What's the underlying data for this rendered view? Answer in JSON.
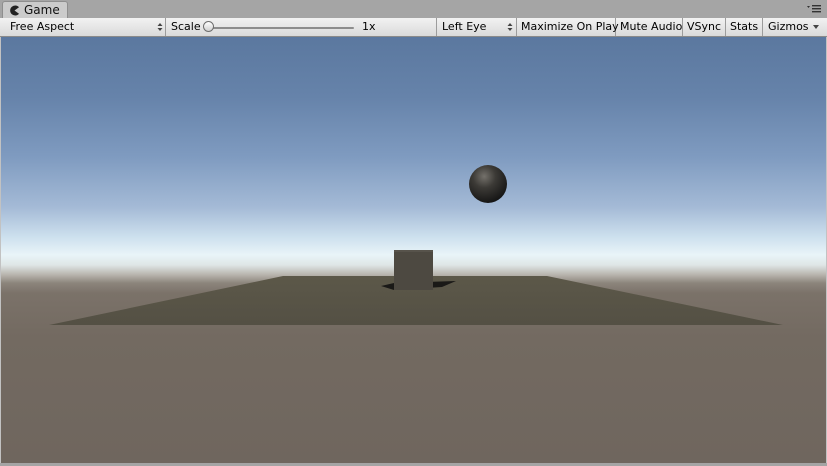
{
  "window": {
    "tab_title": "Game",
    "tab_icon": "pacman-game-icon",
    "panel_menu_icon": "panel-menu-icon"
  },
  "toolbar": {
    "aspect": {
      "value": "Free Aspect"
    },
    "scale": {
      "label": "Scale",
      "value_text": "1x",
      "slider_fraction": 0.0
    },
    "eye": {
      "value": "Left Eye"
    },
    "maximize_label": "Maximize On Play",
    "mute_label": "Mute Audio",
    "vsync_label": "VSync",
    "stats_label": "Stats",
    "gizmos_label": "Gizmos"
  },
  "scene": {
    "objects": [
      "ground-plane",
      "cube",
      "sphere"
    ],
    "colors": {
      "sky_top": "#5b789f",
      "horizon": "#e9f4f8",
      "ground": "#6f665e",
      "plane": "#585446",
      "cube": "#4d4941",
      "sphere": "#2e2c29"
    }
  }
}
